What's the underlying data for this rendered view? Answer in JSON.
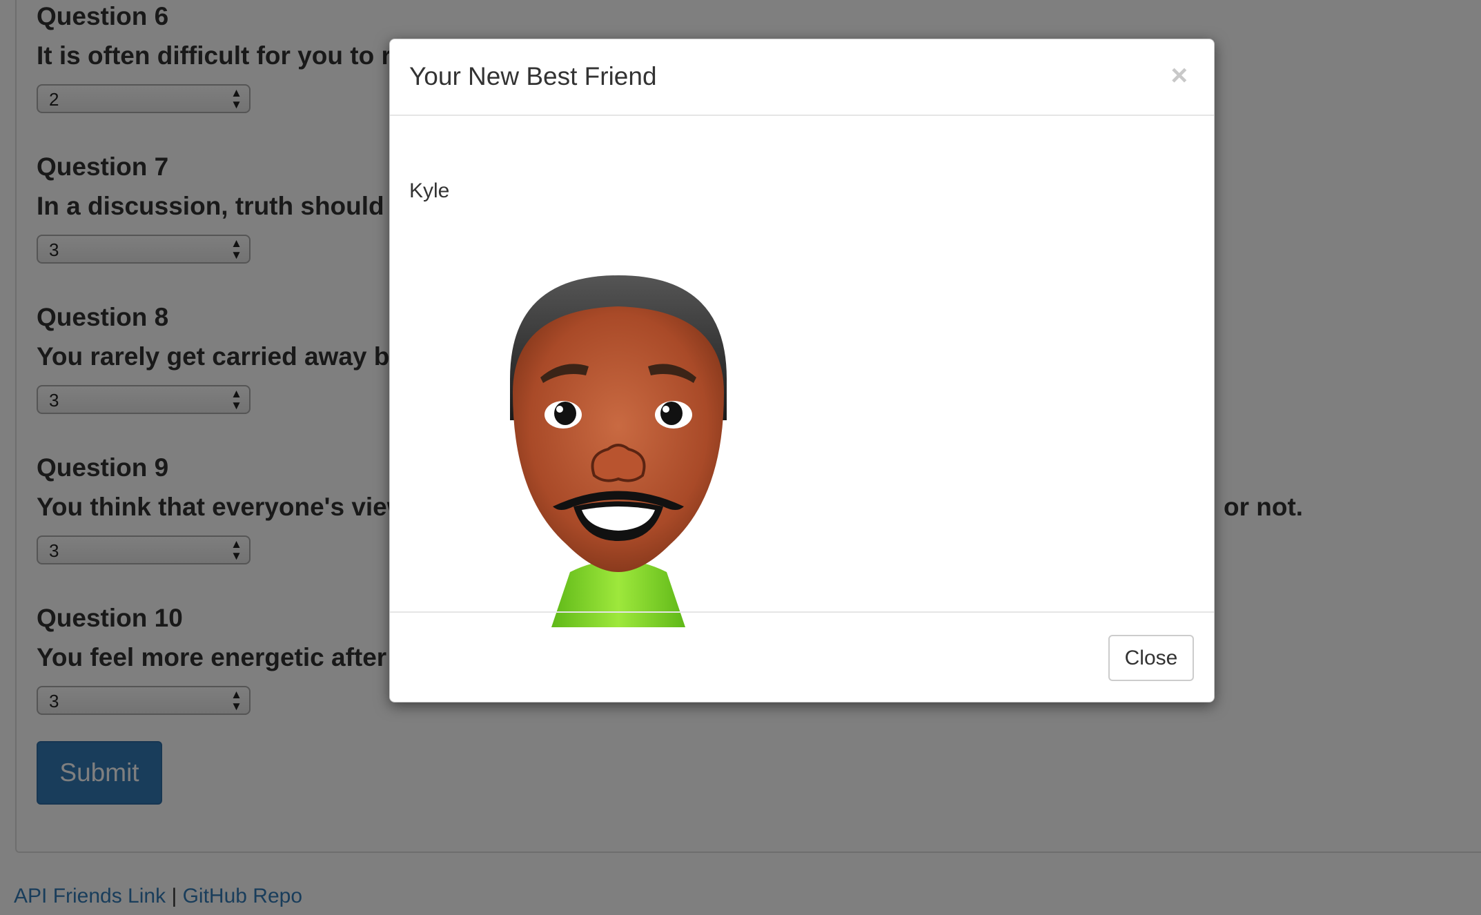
{
  "questions": [
    {
      "title": "Question 6",
      "text": "It is often difficult for you to rel",
      "value": "2"
    },
    {
      "title": "Question 7",
      "text": "In a discussion, truth should be",
      "value": "3"
    },
    {
      "title": "Question 8",
      "text": "You rarely get carried away by",
      "value": "3"
    },
    {
      "title": "Question 9",
      "text": "You think that everyone's views",
      "tail": "or not.",
      "value": "3"
    },
    {
      "title": "Question 10",
      "text": "You feel more energetic after s",
      "value": "3"
    }
  ],
  "submit_label": "Submit",
  "footer": {
    "link1": "API Friends Link",
    "separator": "|",
    "link2": "GitHub Repo"
  },
  "modal": {
    "title": "Your New Best Friend",
    "close_x": "×",
    "friend_name": "Kyle",
    "close_label": "Close"
  },
  "colors": {
    "primary": "#337ab7",
    "backdrop": "rgba(0,0,0,0.5)",
    "shirt": "#7ed321",
    "skin": "#b5532f"
  },
  "icons": {
    "select_arrows": "up-down-arrows-icon",
    "close": "close-icon"
  }
}
